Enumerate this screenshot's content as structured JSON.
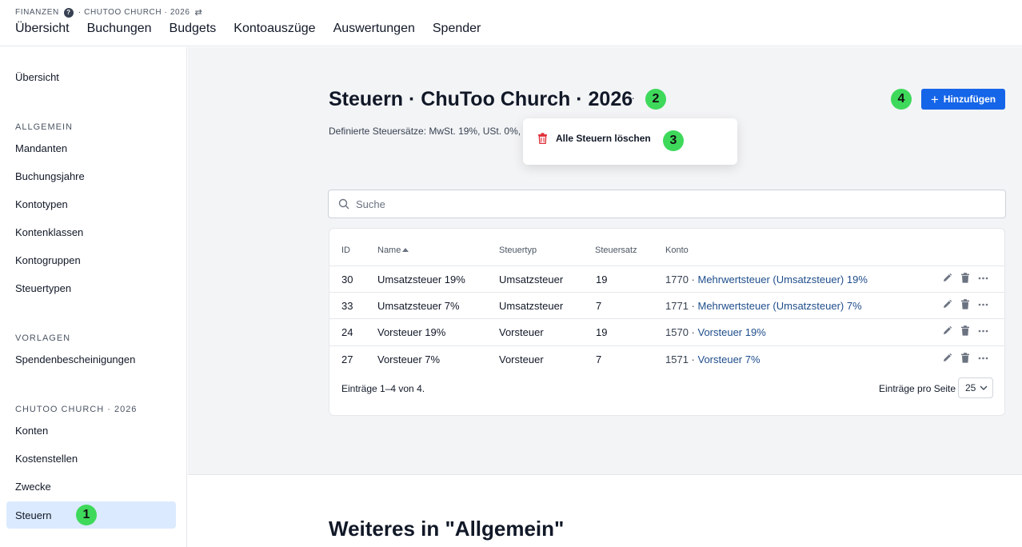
{
  "topbar": {
    "crumb_app": "FINANZEN",
    "crumb_help": "?",
    "crumb_context": "· CHUTOO CHURCH · 2026",
    "crumb_swap": "⇄",
    "nav": [
      "Übersicht",
      "Buchungen",
      "Budgets",
      "Kontoauszüge",
      "Auswertungen",
      "Spender"
    ]
  },
  "sidebar": {
    "overview": "Übersicht",
    "section_general": "ALLGEMEIN",
    "general_items": [
      "Mandanten",
      "Buchungsjahre",
      "Kontotypen",
      "Kontenklassen",
      "Kontogruppen",
      "Steuertypen"
    ],
    "section_templates": "VORLAGEN",
    "template_items": [
      "Spendenbescheinigungen"
    ],
    "section_org": "CHUTOO CHURCH · 2026",
    "org_items": [
      "Konten",
      "Kostenstellen",
      "Zwecke",
      "Steuern"
    ],
    "active": "Steuern"
  },
  "page": {
    "title": "Steuern · ChuToo Church · 2026",
    "more": "···",
    "subtitle": "Definierte Steuersätze: MwSt. 19%, USt. 0%,",
    "add_label": "Hinzufügen",
    "add_plus": "+",
    "dropdown_item": "Alle Steuern löschen",
    "search_placeholder": "Suche",
    "more_heading": "Weiteres in \"Allgemein\""
  },
  "badges": [
    "1",
    "2",
    "3",
    "4"
  ],
  "table": {
    "headers": {
      "id": "ID",
      "name": "Name",
      "type": "Steuertyp",
      "rate": "Steuersatz",
      "account": "Konto"
    },
    "rows": [
      {
        "id": "30",
        "name": "Umsatzsteuer 19%",
        "type": "Umsatzsteuer",
        "rate": "19",
        "acc_no": "1770",
        "acc_name": "Mehrwertsteuer (Umsatzsteuer) 19%"
      },
      {
        "id": "33",
        "name": "Umsatzsteuer 7%",
        "type": "Umsatzsteuer",
        "rate": "7",
        "acc_no": "1771",
        "acc_name": "Mehrwertsteuer (Umsatzsteuer) 7%"
      },
      {
        "id": "24",
        "name": "Vorsteuer 19%",
        "type": "Vorsteuer",
        "rate": "19",
        "acc_no": "1570",
        "acc_name": "Vorsteuer 19%"
      },
      {
        "id": "27",
        "name": "Vorsteuer 7%",
        "type": "Vorsteuer",
        "rate": "7",
        "acc_no": "1571",
        "acc_name": "Vorsteuer 7%"
      }
    ],
    "summary": "Einträge 1–4 von 4.",
    "per_page_label": "Einträge pro Seite",
    "per_page_value": "25"
  },
  "colors": {
    "accent": "#1565e8",
    "badge": "#3ed95b",
    "danger": "#e0303a",
    "active_bg": "#dbeafe"
  }
}
